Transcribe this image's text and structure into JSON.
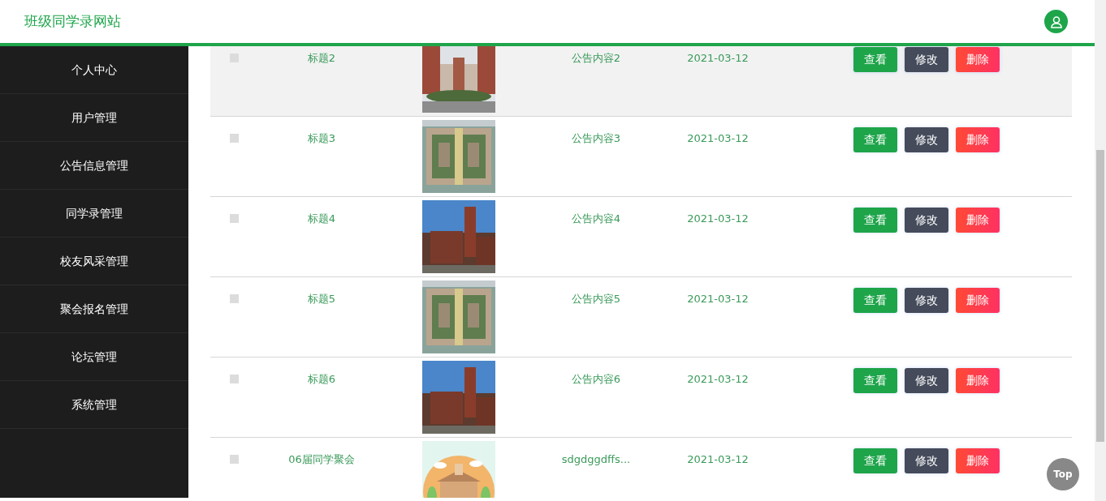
{
  "header": {
    "title": "班级同学录网站"
  },
  "sidebar": {
    "items": [
      {
        "label": "个人中心"
      },
      {
        "label": "用户管理"
      },
      {
        "label": "公告信息管理"
      },
      {
        "label": "同学录管理"
      },
      {
        "label": "校友风采管理"
      },
      {
        "label": "聚会报名管理"
      },
      {
        "label": "论坛管理"
      },
      {
        "label": "系统管理"
      }
    ]
  },
  "table": {
    "rows": [
      {
        "title": "标题2",
        "content": "公告内容2",
        "date": "2021-03-12",
        "highlighted": true,
        "checked": false,
        "actions": [
          {
            "label": "查看",
            "kind": "view"
          },
          {
            "label": "修改",
            "kind": "edit"
          },
          {
            "label": "删除",
            "kind": "delete"
          }
        ]
      },
      {
        "title": "标题3",
        "content": "公告内容3",
        "date": "2021-03-12",
        "highlighted": false,
        "checked": false,
        "actions": [
          {
            "label": "查看",
            "kind": "view"
          },
          {
            "label": "修改",
            "kind": "edit"
          },
          {
            "label": "删除",
            "kind": "delete"
          }
        ]
      },
      {
        "title": "标题4",
        "content": "公告内容4",
        "date": "2021-03-12",
        "highlighted": false,
        "checked": false,
        "actions": [
          {
            "label": "查看",
            "kind": "view"
          },
          {
            "label": "修改",
            "kind": "edit"
          },
          {
            "label": "删除",
            "kind": "delete"
          }
        ]
      },
      {
        "title": "标题5",
        "content": "公告内容5",
        "date": "2021-03-12",
        "highlighted": false,
        "checked": false,
        "actions": [
          {
            "label": "查看",
            "kind": "view"
          },
          {
            "label": "修改",
            "kind": "edit"
          },
          {
            "label": "删除",
            "kind": "delete"
          }
        ]
      },
      {
        "title": "标题6",
        "content": "公告内容6",
        "date": "2021-03-12",
        "highlighted": false,
        "checked": false,
        "actions": [
          {
            "label": "查看",
            "kind": "view"
          },
          {
            "label": "修改",
            "kind": "edit"
          },
          {
            "label": "删除",
            "kind": "delete"
          }
        ]
      },
      {
        "title": "06届同学聚会",
        "content": "sdgdggdffs...",
        "date": "2021-03-12",
        "highlighted": false,
        "checked": false,
        "actions": [
          {
            "label": "查看",
            "kind": "view"
          },
          {
            "label": "修改",
            "kind": "edit"
          },
          {
            "label": "删除",
            "kind": "delete"
          }
        ]
      }
    ]
  },
  "back_to_top": {
    "label": "Top"
  }
}
